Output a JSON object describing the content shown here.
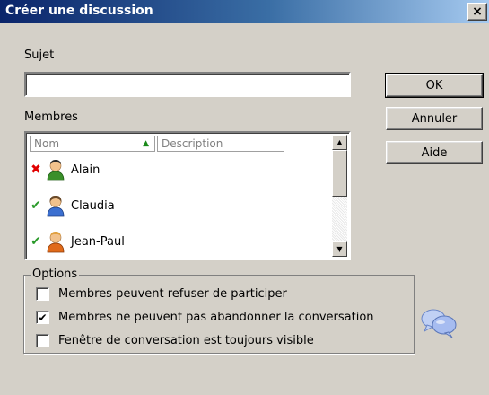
{
  "window": {
    "title": "Créer une discussion",
    "close_glyph": "×"
  },
  "subject": {
    "label": "Sujet",
    "value": ""
  },
  "members": {
    "label": "Membres",
    "columns": {
      "name": "Nom",
      "description": "Description",
      "sort_glyph": "▲"
    },
    "items": [
      {
        "name": "Alain",
        "status": "declined",
        "status_glyph": "✖",
        "avatar_color": "#3a8f2a",
        "hair_color": "#2a2a2a"
      },
      {
        "name": "Claudia",
        "status": "accepted",
        "status_glyph": "✔",
        "avatar_color": "#3b6fd0",
        "hair_color": "#6a4a2a"
      },
      {
        "name": "Jean-Paul",
        "status": "accepted",
        "status_glyph": "✔",
        "avatar_color": "#e06a1a",
        "hair_color": "#e0a040"
      }
    ],
    "scroll_up_glyph": "▲",
    "scroll_down_glyph": "▼"
  },
  "buttons": {
    "ok": "OK",
    "cancel": "Annuler",
    "help": "Aide"
  },
  "options": {
    "legend": "Options",
    "items": [
      {
        "label": "Membres peuvent refuser de participer",
        "checked": false,
        "mark": ""
      },
      {
        "label": "Membres ne peuvent pas abandonner la conversation",
        "checked": true,
        "mark": "✔"
      },
      {
        "label": "Fenêtre de conversation est toujours visible",
        "checked": false,
        "mark": ""
      }
    ]
  },
  "icons": {
    "discussion": "chat-bubbles-icon"
  }
}
